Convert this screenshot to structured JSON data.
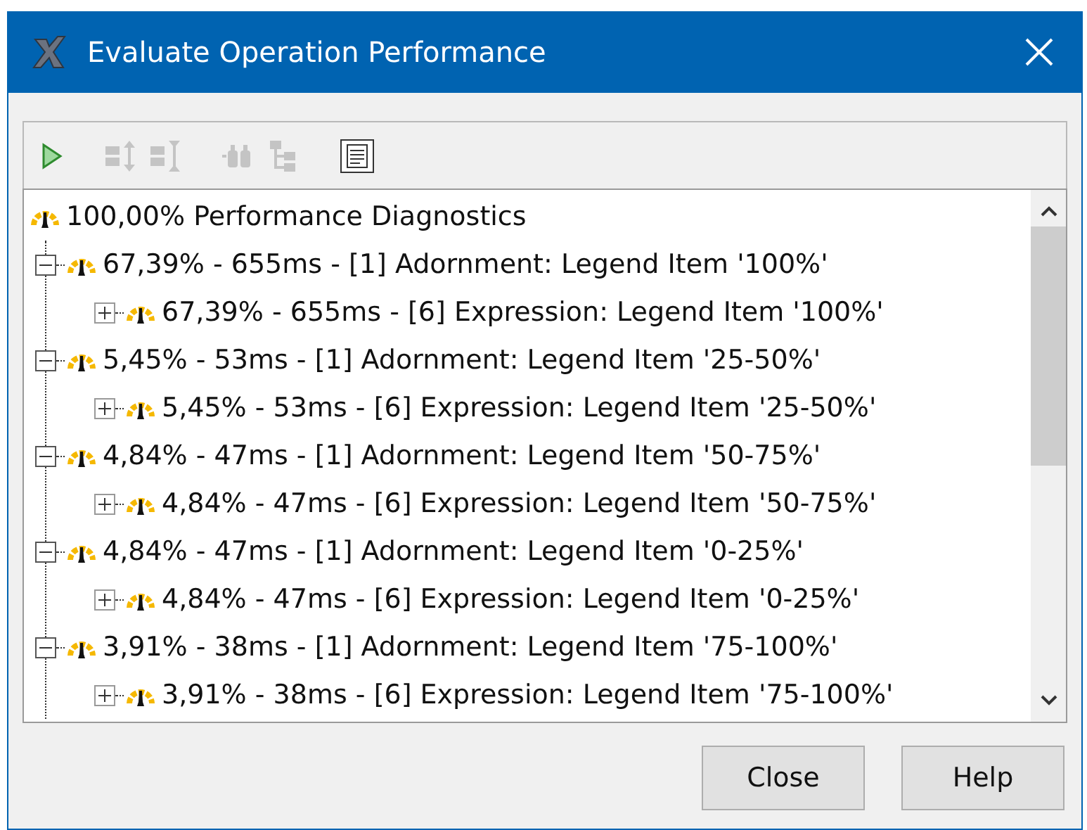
{
  "window": {
    "title": "Evaluate Operation Performance"
  },
  "toolbar": [
    {
      "kind": "run",
      "disabled": false
    },
    {
      "kind": "expand",
      "disabled": true
    },
    {
      "kind": "collapse",
      "disabled": true
    },
    {
      "kind": "find",
      "disabled": true
    },
    {
      "kind": "tree",
      "disabled": true
    },
    {
      "kind": "report",
      "disabled": false
    }
  ],
  "tree": {
    "root": "100,00% Performance Diagnostics",
    "items": [
      {
        "label": "67,39% - 655ms - [1] Adornment: Legend Item '100%'",
        "expanded": true,
        "children": [
          {
            "label": "67,39% - 655ms - [6] Expression: Legend Item '100%'",
            "expanded": false
          }
        ]
      },
      {
        "label": "5,45% - 53ms - [1] Adornment: Legend Item '25-50%'",
        "expanded": true,
        "children": [
          {
            "label": "5,45% - 53ms - [6] Expression: Legend Item '25-50%'",
            "expanded": false
          }
        ]
      },
      {
        "label": "4,84% - 47ms - [1] Adornment: Legend Item '50-75%'",
        "expanded": true,
        "children": [
          {
            "label": "4,84% - 47ms - [6] Expression: Legend Item '50-75%'",
            "expanded": false
          }
        ]
      },
      {
        "label": "4,84% - 47ms - [1] Adornment: Legend Item '0-25%'",
        "expanded": true,
        "children": [
          {
            "label": "4,84% - 47ms - [6] Expression: Legend Item '0-25%'",
            "expanded": false
          }
        ]
      },
      {
        "label": "3,91% - 38ms - [1] Adornment: Legend Item '75-100%'",
        "expanded": true,
        "children": [
          {
            "label": "3,91% - 38ms - [6] Expression: Legend Item '75-100%'",
            "expanded": false
          }
        ]
      }
    ]
  },
  "buttons": [
    "Close",
    "Help"
  ]
}
